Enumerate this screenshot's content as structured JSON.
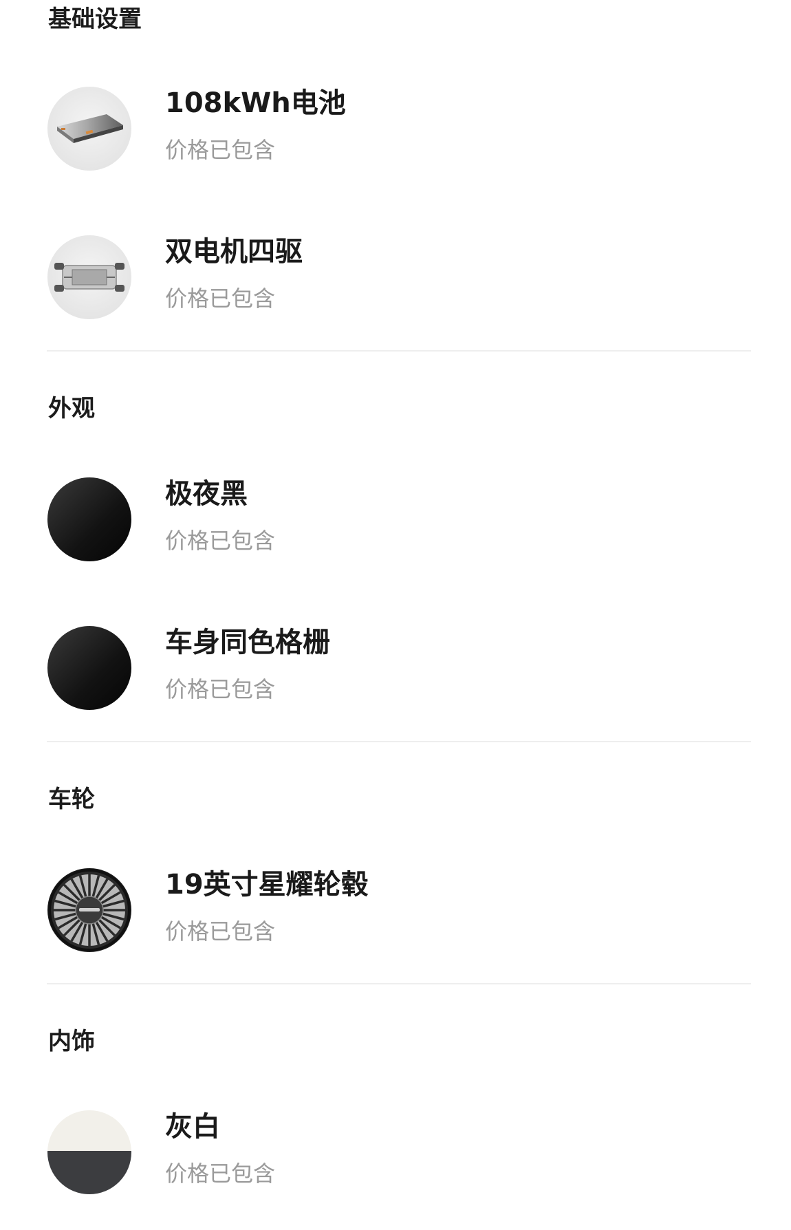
{
  "sections": [
    {
      "title": "基础设置",
      "items": [
        {
          "name": "108kWh电池",
          "price": "价格已包含",
          "icon": "battery-pack-icon"
        },
        {
          "name": "双电机四驱",
          "price": "价格已包含",
          "icon": "chassis-icon"
        }
      ]
    },
    {
      "title": "外观",
      "items": [
        {
          "name": "极夜黑",
          "price": "价格已包含",
          "icon": "black-swatch-icon",
          "color": "#111111"
        },
        {
          "name": "车身同色格栅",
          "price": "价格已包含",
          "icon": "black-swatch-icon",
          "color": "#111111"
        }
      ]
    },
    {
      "title": "车轮",
      "items": [
        {
          "name": "19英寸星耀轮毂",
          "price": "价格已包含",
          "icon": "wheel-rim-icon"
        }
      ]
    },
    {
      "title": "内饰",
      "items": [
        {
          "name": "灰白",
          "price": "价格已包含",
          "icon": "grey-white-swatch-icon",
          "colors": [
            "#f2f0ea",
            "#3c3d40"
          ]
        }
      ]
    }
  ]
}
